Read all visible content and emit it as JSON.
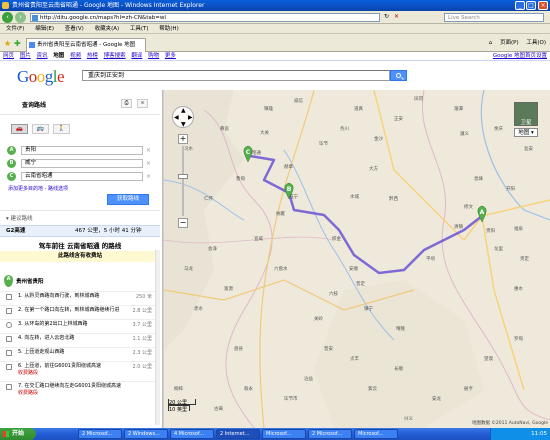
{
  "window": {
    "title": "贵州省贵阳至云南省昭通 - Google 地图 - Windows Internet Explorer"
  },
  "address": {
    "url": "http://ditu.google.cn/maps?hl=zh-CN&tab=wl",
    "search_placeholder": "Live Search"
  },
  "menu": [
    "文件(F)",
    "编辑(E)",
    "查看(V)",
    "收藏夹(A)",
    "工具(T)",
    "帮助(H)"
  ],
  "tab": {
    "label": "贵州省贵阳至云南省昭通 - Google 地图"
  },
  "tabtools": {
    "page": "页面(P)",
    "tools": "工具(O)"
  },
  "gbar": {
    "links": [
      "网页",
      "图片",
      "资讯",
      "地图",
      "视频",
      "热榜",
      "博客搜索",
      "翻译",
      "购物",
      "更多"
    ],
    "current": "地图",
    "right": "Google 地图首页设置"
  },
  "header": {
    "logo": [
      "G",
      "o",
      "o",
      "g",
      "l",
      "e"
    ],
    "logo_colors": [
      "#1a5ad8",
      "#d52a1b",
      "#f2b310",
      "#1a5ad8",
      "#21a13b",
      "#d52a1b"
    ],
    "query": "重庆到正安到"
  },
  "sidebar": {
    "title": "查询路线",
    "print_icon": "printer-icon",
    "link_icon": "link-icon",
    "modes": [
      "car",
      "transit",
      "walk"
    ],
    "waypoints": [
      {
        "letter": "A",
        "value": "贵阳"
      },
      {
        "letter": "B",
        "value": "威宁"
      },
      {
        "letter": "C",
        "value": "云南省昭通"
      }
    ],
    "add_links": "添加更多目的地 - 路线选项",
    "go_button": "获取路线",
    "suggest": "建议路线",
    "route": {
      "name": "G2高速",
      "summary": "467 公里，5 小时 41 分钟"
    },
    "drive_heading": "驾车前往 云南省昭通 的路线",
    "toll_note": "此路线含有收费站",
    "start": {
      "letter": "A",
      "name": "贵州省贵阳"
    },
    "steps": [
      {
        "n": "1.",
        "text": "从黔灵西路向西行驶，到林城西路",
        "dist": "250 米",
        "toll": ""
      },
      {
        "n": "2.",
        "text": "在第一个路口向左转，到林城西路继续行进",
        "dist": "2.8 公里",
        "toll": ""
      },
      {
        "n": "3.",
        "text": "从环岛的第2出口上林城西路",
        "dist": "3.7 公里",
        "toll": ""
      },
      {
        "n": "4.",
        "text": "向左转，进入云岩北路",
        "dist": "1.1 公里",
        "toll": ""
      },
      {
        "n": "5.",
        "text": "上匝道走观山西路",
        "dist": "2.3 公里",
        "toll": ""
      },
      {
        "n": "6.",
        "text": "上匝道，前往G6001贵阳绕城高速",
        "dist": "2.0 公里",
        "toll": "收费路段"
      },
      {
        "n": "7.",
        "text": "在交汇路口继续向左走G6001贵阳绕城高速",
        "dist": "",
        "toll": "收费路段"
      }
    ]
  },
  "map": {
    "mode": "卫星",
    "map_button": "地图",
    "scale": [
      "20 公里",
      "10 英里"
    ],
    "copyright": "地图数据 ©2011 AutoNavi, Google",
    "markers": [
      {
        "letter": "A",
        "color": "#55b04b"
      },
      {
        "letter": "B",
        "color": "#55b04b"
      },
      {
        "letter": "C",
        "color": "#55b04b"
      }
    ],
    "towns": [
      "毕节",
      "纳雍",
      "六枝",
      "安顺",
      "盘县",
      "兴义",
      "威宁",
      "赫章",
      "大方",
      "黔西",
      "清镇",
      "贵阳",
      "遵义",
      "金沙",
      "织金",
      "普定",
      "水城",
      "镇宁",
      "关岭",
      "晴隆",
      "六盘水",
      "普安",
      "彝良",
      "镇雄",
      "威信",
      "鲁甸",
      "会泽",
      "宣威",
      "昭通",
      "大关",
      "修文",
      "息烽",
      "开阳",
      "龙里",
      "平坝",
      "长顺",
      "紫云",
      "贞丰",
      "安龙",
      "册亨",
      "望谟",
      "罗甸",
      "惠水",
      "贵定",
      "福泉",
      "瓮安",
      "余庆",
      "湄潭",
      "凤冈",
      "绥阳",
      "正安",
      "道真",
      "务川",
      "仁怀",
      "习水",
      "赤水",
      "桐梓",
      "古蔺",
      "叙永",
      "毕节市",
      "沾益",
      "马龙",
      "富源",
      "罗平",
      "师宗",
      "陆良",
      "曲靖"
    ]
  },
  "taskbar": {
    "start": "开始",
    "tasks": [
      "2 Microsof...",
      "2 Windows...",
      "4 Microsof...",
      "2 Internet...",
      "Microsof...",
      "2 Microsof...",
      "Microsof..."
    ],
    "time": "11:05"
  }
}
